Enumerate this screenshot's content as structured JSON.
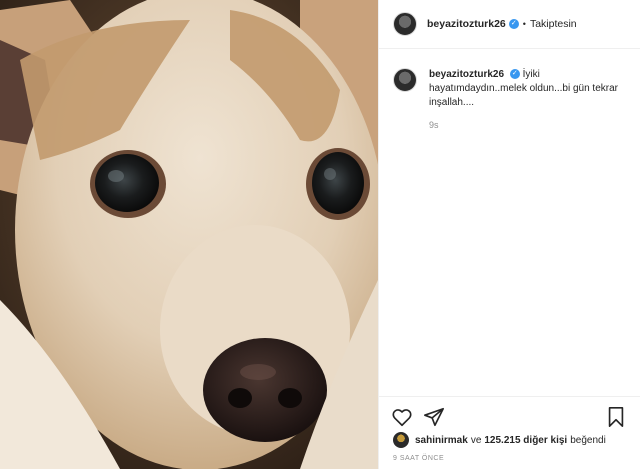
{
  "header": {
    "username": "beyazitozturk26",
    "follow_label": "Takiptesin"
  },
  "caption": {
    "username": "beyazitozturk26",
    "text": "İyiki hayatımdaydın..melek oldun...bi gün tekrar inşallah....",
    "time": "9s"
  },
  "likes": {
    "username": "sahinirmak",
    "mid": "ve",
    "count": "125.215 diğer kişi",
    "suffix": "beğendi"
  },
  "timestamp": "9 SAAT ÖNCE",
  "icons": {
    "like": "heart-icon",
    "share": "paper-plane-icon",
    "save": "bookmark-icon"
  },
  "colors": {
    "verified": "#3897f0",
    "meta_gray": "#8e8e8e"
  }
}
